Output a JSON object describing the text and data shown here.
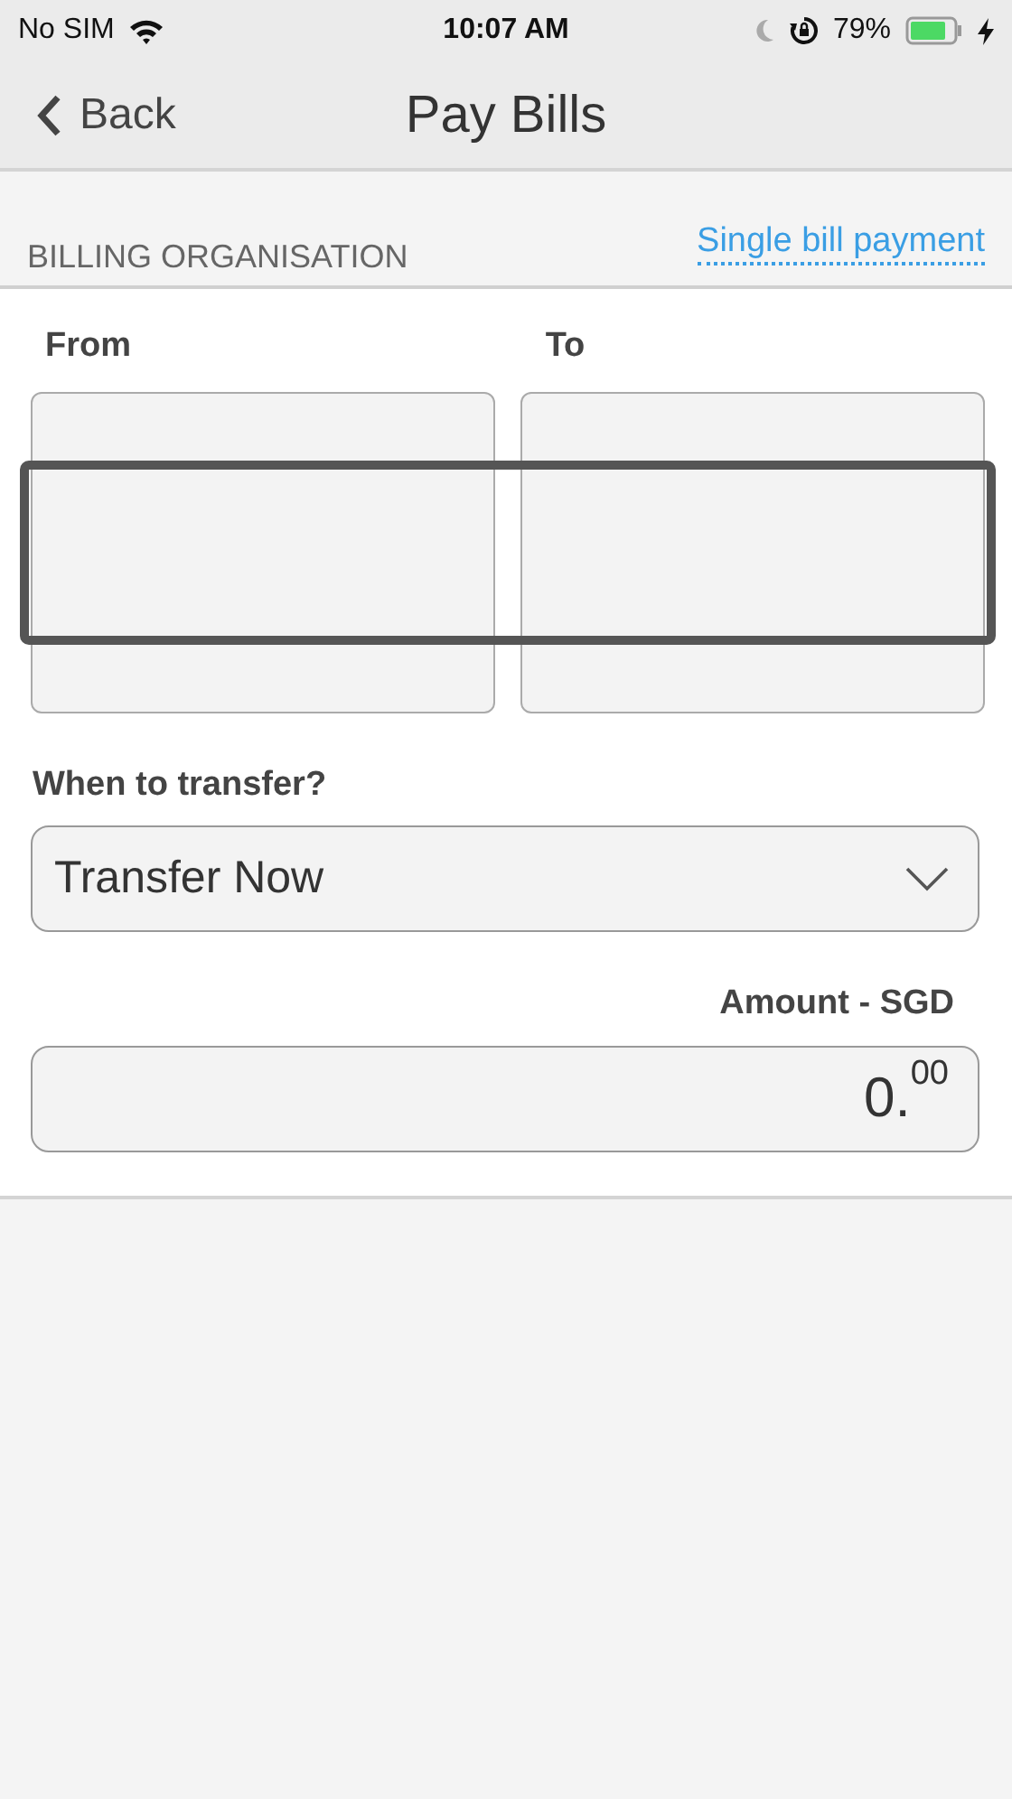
{
  "status_bar": {
    "carrier": "No SIM",
    "time": "10:07 AM",
    "battery": "79%",
    "charging": true
  },
  "nav": {
    "back": "Back",
    "title": "Pay Bills"
  },
  "section": {
    "title": "BILLING ORGANISATION",
    "link": "Single bill payment"
  },
  "pickers": [
    {
      "label": "From"
    },
    {
      "label": "To"
    }
  ],
  "when": {
    "label": "When to transfer?",
    "value": "Transfer Now"
  },
  "amount": {
    "label": "Amount - SGD",
    "value": "0.$^{00}$"
  }
}
